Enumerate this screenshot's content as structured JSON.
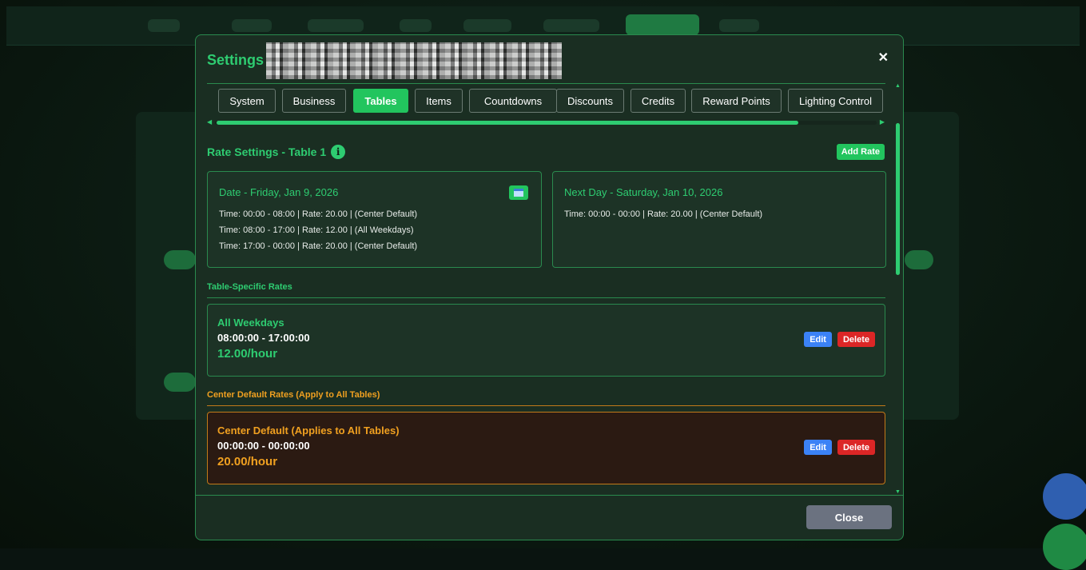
{
  "modal": {
    "title": "Settings -",
    "close_label": "Close"
  },
  "tabs": [
    {
      "label": "System"
    },
    {
      "label": "Business"
    },
    {
      "label": "Tables"
    },
    {
      "label": "Items"
    },
    {
      "label": "Countdowns"
    },
    {
      "label": "Discounts"
    },
    {
      "label": "Credits"
    },
    {
      "label": "Reward Points"
    },
    {
      "label": "Lighting Control"
    }
  ],
  "active_tab": "Tables",
  "rate_settings": {
    "title": "Rate Settings - Table 1",
    "info_glyph": "i",
    "add_label": "Add Rate",
    "today": {
      "title": "Date - Friday, Jan 9, 2026",
      "lines": [
        "Time: 00:00 - 08:00 | Rate: 20.00 | (Center Default)",
        "Time: 08:00 - 17:00 | Rate: 12.00 | (All Weekdays)",
        "Time: 17:00 - 00:00 | Rate: 20.00 | (Center Default)"
      ]
    },
    "next_day": {
      "title": "Next Day - Saturday, Jan 10, 2026",
      "lines": [
        "Time: 00:00 - 00:00 | Rate: 20.00 | (Center Default)"
      ]
    }
  },
  "table_specific": {
    "heading": "Table-Specific Rates",
    "rate": {
      "name": "All Weekdays",
      "time": "08:00:00 - 17:00:00",
      "price": "12.00/hour",
      "edit_label": "Edit",
      "delete_label": "Delete"
    }
  },
  "center_default": {
    "heading": "Center Default Rates (Apply to All Tables)",
    "rate": {
      "name": "Center Default (Applies to All Tables)",
      "time": "00:00:00 - 00:00:00",
      "price": "20.00/hour",
      "edit_label": "Edit",
      "delete_label": "Delete"
    }
  },
  "colors": {
    "accent": "#2ecc71",
    "active_tab": "#22c55e",
    "center_default": "#f0a020",
    "edit": "#3b82f6",
    "delete": "#dc2626",
    "close": "#6b7280"
  }
}
